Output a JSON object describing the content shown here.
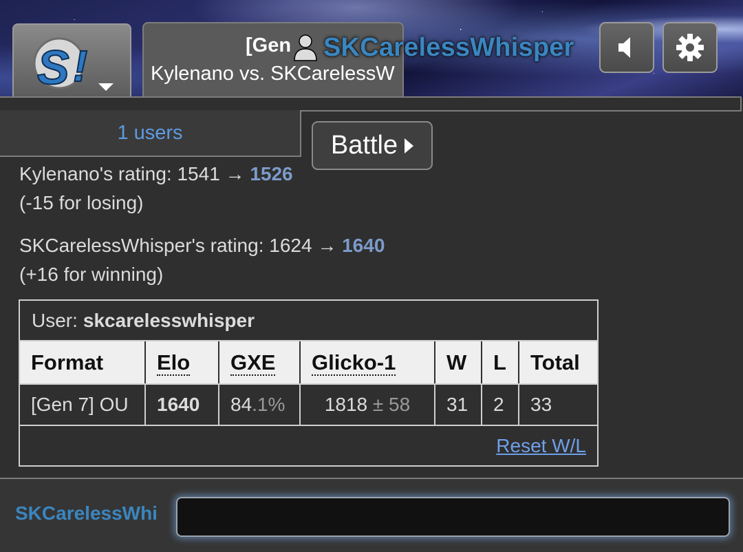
{
  "header": {
    "room_tab": {
      "format": "[Gen",
      "title": "Kylenano vs. SKCarelessW"
    },
    "current_user": "SKCarelessWhisper",
    "buttons": {
      "sound_icon": "speaker-icon",
      "options_icon": "gear-icon"
    },
    "logo_icon": "showdown-logo-icon"
  },
  "room": {
    "userlist_label": "1 users",
    "battle_button_label": "Battle",
    "log": [
      {
        "line1_prefix": "Kylenano's rating: 1541 → ",
        "new_rating": "1526",
        "line2": "(-15 for losing)"
      },
      {
        "line1_prefix": "SKCarelessWhisper's rating: 1624 → ",
        "new_rating": "1640",
        "line2": "(+16 for winning)"
      }
    ]
  },
  "rank_table": {
    "user_label": "User:",
    "user_name": "skcarelesswhisper",
    "headers": [
      "Format",
      "Elo",
      "GXE",
      "Glicko-1",
      "W",
      "L",
      "Total"
    ],
    "row": {
      "format": "[Gen 7] OU",
      "elo": "1640",
      "gxe_main": "84",
      "gxe_dim": ".1%",
      "glicko_main": "1818",
      "glicko_dim": "± 58",
      "w": "31",
      "l": "2",
      "total": "33"
    },
    "reset_link": "Reset W/L"
  },
  "chat": {
    "username": "SKCarelessWhi",
    "input_value": ""
  },
  "colors": {
    "accent_blue": "#3a86c0",
    "rating_blue": "#7c9bcb",
    "link_blue": "#6fa0e8"
  }
}
